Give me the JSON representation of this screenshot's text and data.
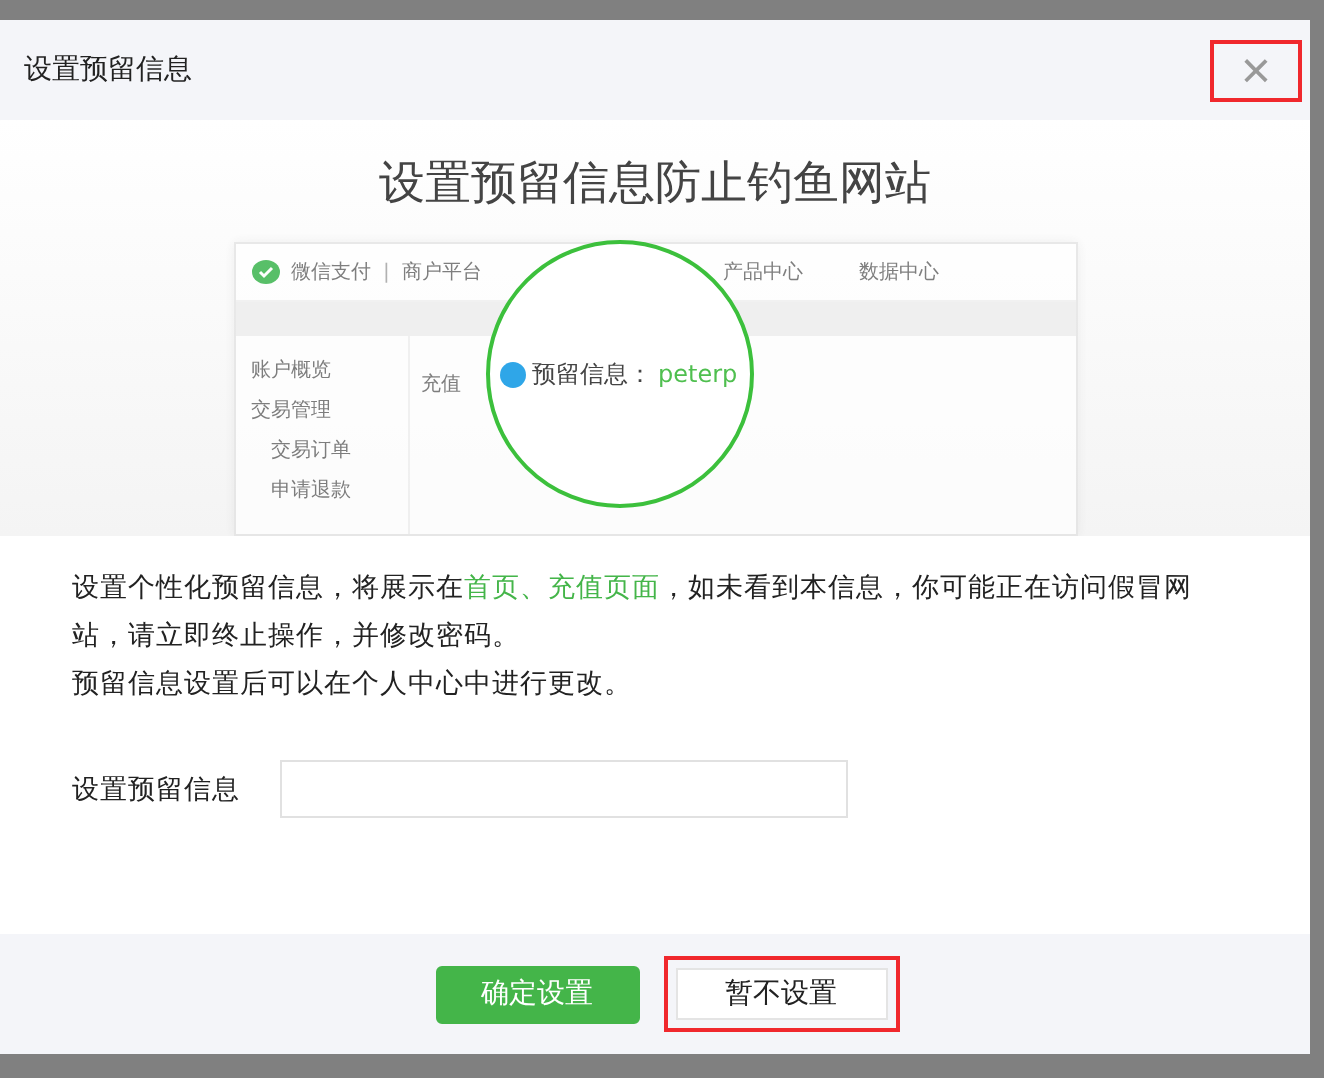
{
  "dialog": {
    "title": "设置预留信息",
    "close": {
      "label": "×",
      "highlighted": true
    }
  },
  "banner": {
    "heading": "设置预留信息防止钓鱼网站",
    "preview": {
      "brand": "微信支付",
      "separator": "|",
      "platform": "商户平台",
      "nav": [
        "产品中心",
        "数据中心"
      ],
      "sidebar": [
        "账户概览",
        "交易管理",
        "交易订单",
        "申请退款"
      ],
      "tab": "充值",
      "magnifier": {
        "label": "预留信息：",
        "value": "peterp"
      }
    }
  },
  "description": [
    "设置个性化预留信息，将展示在**首页、充值页面**，如未看到本信息，你可能正在访问假冒网站，请立即终止操作，并修改密码。",
    "预留信息设置后可以在个人中心中进行更改。"
  ],
  "field": {
    "label": "设置预留信息"
  },
  "buttons": [
    {
      "label": "确定设置",
      "kind": "primary",
      "highlighted": false
    },
    {
      "label": "暂不设置",
      "kind": "secondary",
      "highlighted": true
    }
  ]
}
